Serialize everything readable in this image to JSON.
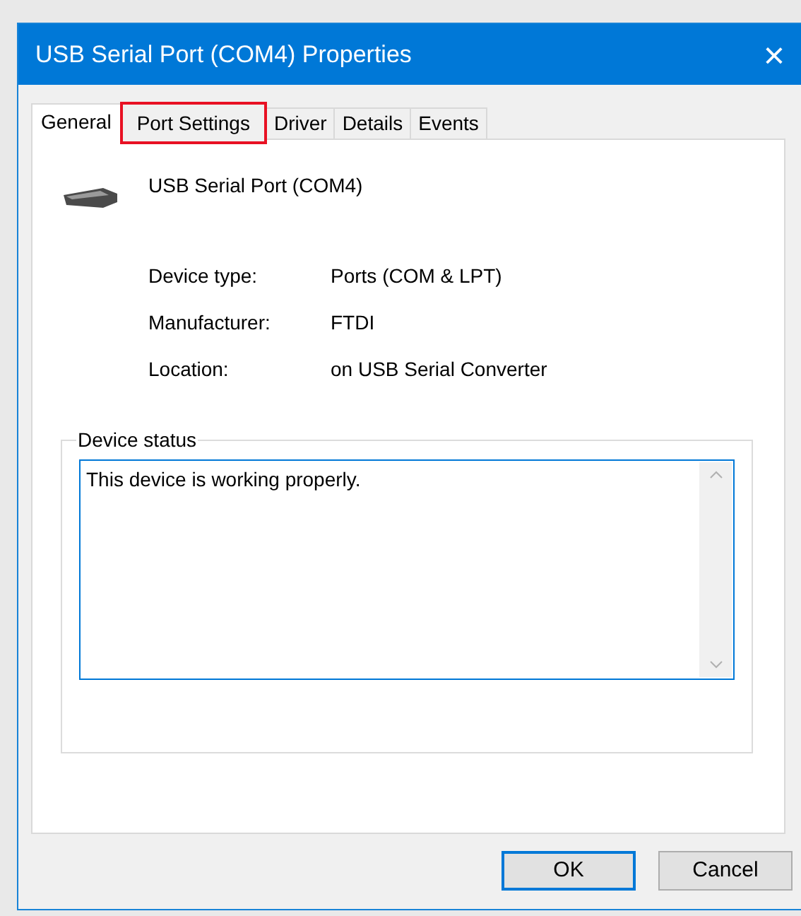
{
  "window": {
    "title": "USB Serial Port (COM4) Properties",
    "close": "×"
  },
  "tabs": [
    {
      "label": "General",
      "selected": true,
      "highlighted": false
    },
    {
      "label": "Port Settings",
      "selected": false,
      "highlighted": true
    },
    {
      "label": "Driver",
      "selected": false,
      "highlighted": false
    },
    {
      "label": "Details",
      "selected": false,
      "highlighted": false
    },
    {
      "label": "Events",
      "selected": false,
      "highlighted": false
    }
  ],
  "device": {
    "name": "USB Serial Port (COM4)"
  },
  "properties": [
    {
      "label": "Device type:",
      "value": "Ports (COM & LPT)"
    },
    {
      "label": "Manufacturer:",
      "value": "FTDI"
    },
    {
      "label": "Location:",
      "value": "on USB Serial Converter"
    }
  ],
  "device_status": {
    "legend": "Device status",
    "text": "This device is working properly."
  },
  "buttons": [
    {
      "label": "OK",
      "default": true
    },
    {
      "label": "Cancel",
      "default": false
    }
  ]
}
